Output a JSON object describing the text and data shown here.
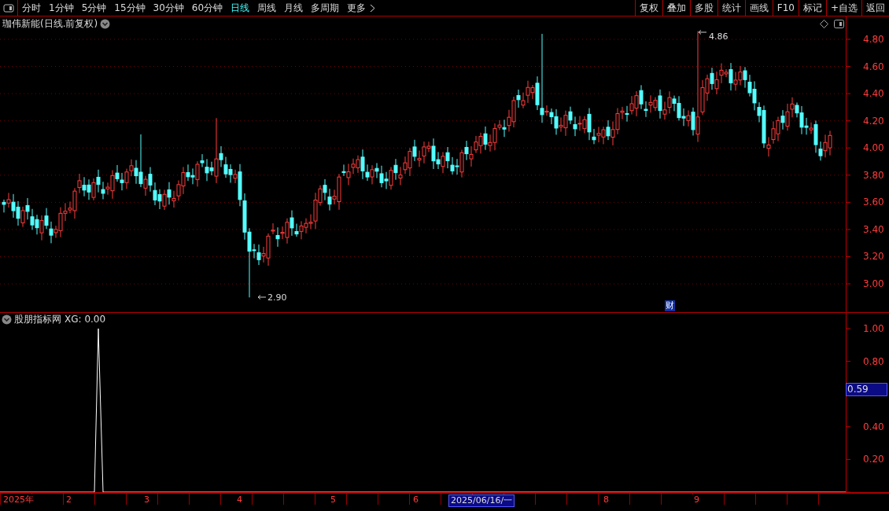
{
  "toolbar": {
    "periods": [
      {
        "label": "分时",
        "selected": false
      },
      {
        "label": "1分钟",
        "selected": false
      },
      {
        "label": "5分钟",
        "selected": false
      },
      {
        "label": "15分钟",
        "selected": false
      },
      {
        "label": "30分钟",
        "selected": false
      },
      {
        "label": "60分钟",
        "selected": false
      },
      {
        "label": "日线",
        "selected": true
      },
      {
        "label": "周线",
        "selected": false
      },
      {
        "label": "月线",
        "selected": false
      },
      {
        "label": "多周期",
        "selected": false
      },
      {
        "label": "更多",
        "selected": false
      }
    ],
    "buttons": [
      "复权",
      "叠加",
      "多股",
      "统计",
      "画线",
      "F10",
      "标记",
      "+自选",
      "返回"
    ]
  },
  "main_chart": {
    "title": "珈伟新能(日线.前复权)",
    "y_labels": [
      "4.80",
      "4.60",
      "4.40",
      "4.20",
      "4.00",
      "3.80",
      "3.60",
      "3.40",
      "3.20",
      "3.00"
    ],
    "high_label": "4.86",
    "low_label": "2.90",
    "event_badge": "财"
  },
  "indicator": {
    "title": "股朋指标网",
    "reading": "XG: 0.00",
    "y_labels": [
      "1.00",
      "0.80",
      "0.40",
      "0.20"
    ],
    "cursor_value": "0.59"
  },
  "time_axis": {
    "labels": [
      {
        "text": "2025年",
        "selected": false
      },
      {
        "text": "2",
        "selected": false
      },
      {
        "text": "3",
        "selected": false
      },
      {
        "text": "4",
        "selected": false
      },
      {
        "text": "5",
        "selected": false
      },
      {
        "text": "6",
        "selected": false
      },
      {
        "text": "2025/06/16/一",
        "selected": true
      },
      {
        "text": "8",
        "selected": false
      },
      {
        "text": "9",
        "selected": false
      }
    ]
  }
}
